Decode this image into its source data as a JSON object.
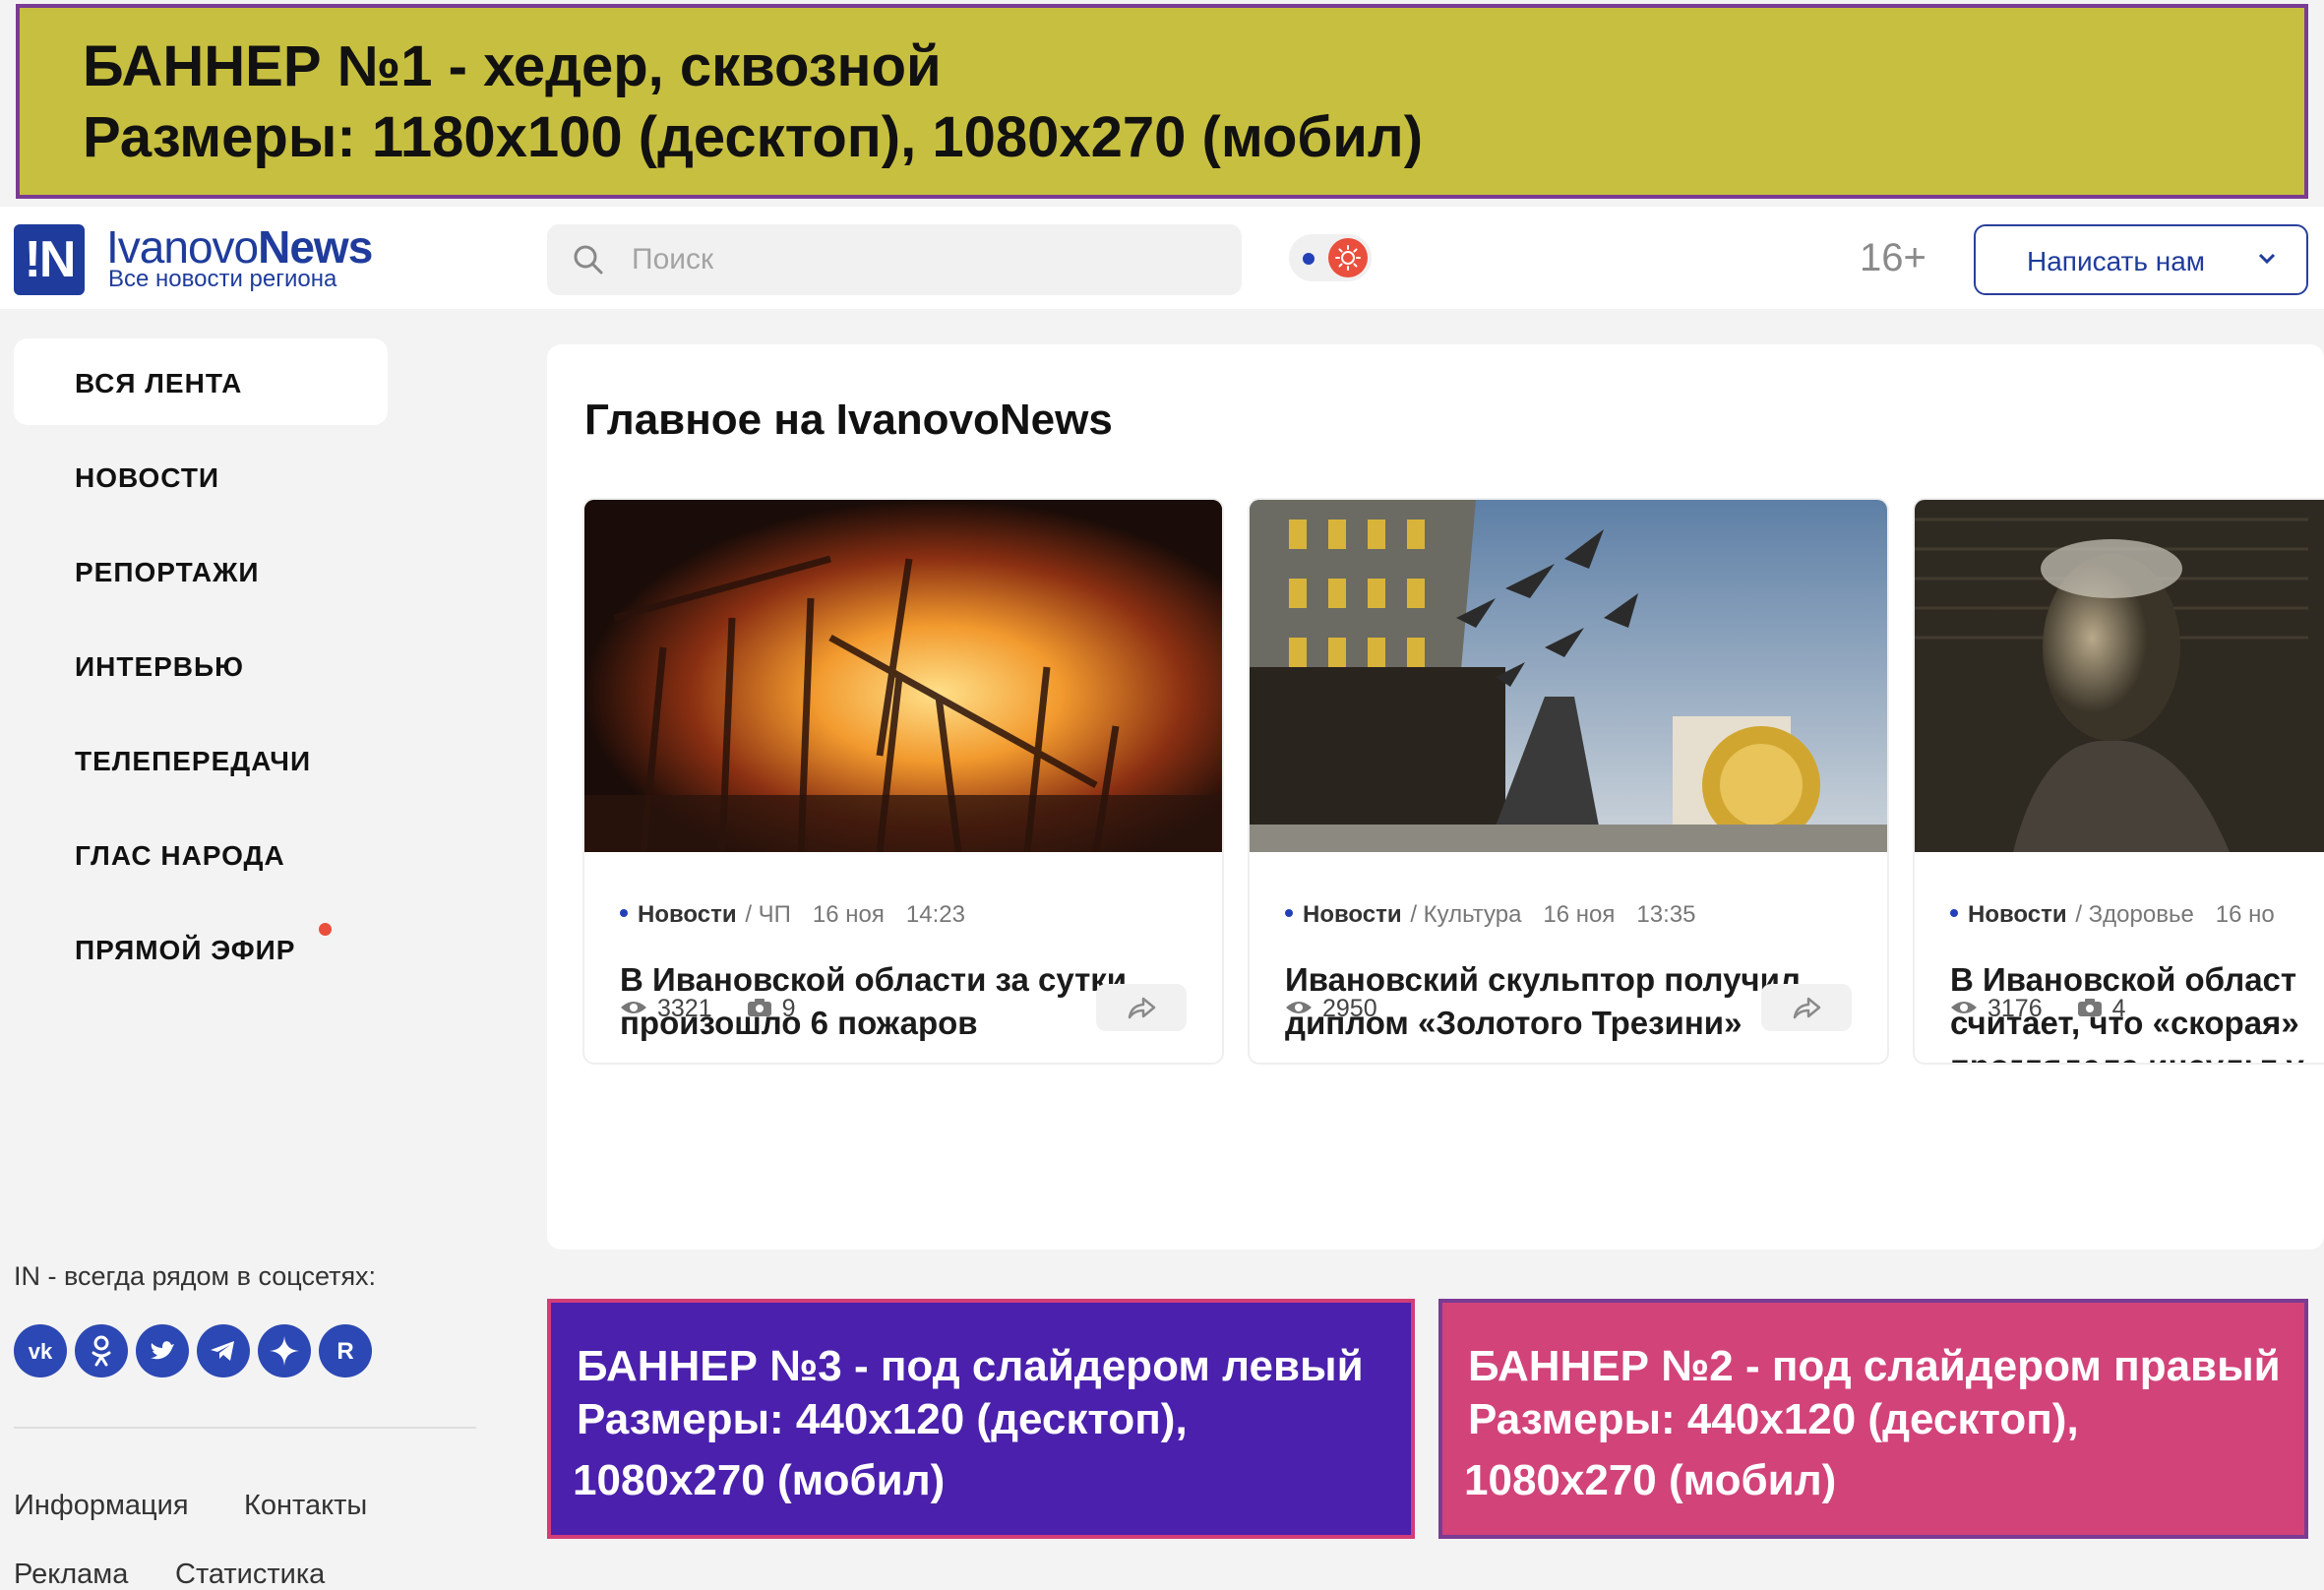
{
  "banners": {
    "top": {
      "line1": "БАННЕР №1 - хедер, сквозной",
      "line2": "Размеры: 1180x100 (десктоп),  1080x270 (мобил)",
      "color": "#c7bf3f"
    },
    "left": {
      "line1": "БАННЕР №3 - под слайдером левый",
      "line2": "Размеры: 440x120 (десктоп),",
      "line3": "1080x270 (мобил)",
      "color": "#4a20ad"
    },
    "right": {
      "line1": "БАННЕР №2 - под слайдером правый",
      "line2": "Размеры: 440x120 (десктоп),",
      "line3": "1080x270 (мобил)",
      "color": "#d2437a"
    }
  },
  "header": {
    "logo_mark": "!N",
    "logo_name_light": "Ivanovo",
    "logo_name_bold": "News",
    "logo_tagline": "Все новости региона",
    "search_placeholder": "Поиск",
    "age_rating": "16+",
    "write_button": "Написать нам",
    "brand_color": "#1f3c9c"
  },
  "sidebar": {
    "items": [
      {
        "label": "ВСЯ ЛЕНТА"
      },
      {
        "label": "НОВОСТИ"
      },
      {
        "label": "РЕПОРТАЖИ"
      },
      {
        "label": "ИНТЕРВЬЮ"
      },
      {
        "label": "ТЕЛЕПЕРЕДАЧИ"
      },
      {
        "label": "ГЛАС НАРОДА"
      },
      {
        "label": "ПРЯМОЙ ЭФИР"
      }
    ],
    "social_title": "IN - всегда рядом в соцсетях:",
    "socials": [
      {
        "icon": "vk-icon",
        "glyph": "vk"
      },
      {
        "icon": "odnoklassniki-icon",
        "glyph": "ok"
      },
      {
        "icon": "twitter-icon",
        "glyph": "tw"
      },
      {
        "icon": "telegram-icon",
        "glyph": "tg"
      },
      {
        "icon": "zen-icon",
        "glyph": "✦"
      },
      {
        "icon": "rutube-icon",
        "glyph": "R"
      }
    ],
    "footer_links": [
      "Информация",
      "Контакты",
      "Реклама",
      "Статистика"
    ]
  },
  "main": {
    "title": "Главное на IvanovoNews",
    "news": [
      {
        "category": "Новости",
        "subcategory": "/ ЧП",
        "date": "16 ноя",
        "time": "14:23",
        "headline": "В Ивановской области за сутки произошло 6 пожаров",
        "views": "3321",
        "photos": "9"
      },
      {
        "category": "Новости",
        "subcategory": "/ Культура",
        "date": "16 ноя",
        "time": "13:35",
        "headline": "Ивановский скульптор получил диплом «Золотого Трезини»",
        "views": "2950",
        "photos": ""
      },
      {
        "category": "Новости",
        "subcategory": "/ Здоровье",
        "date": "16 но",
        "time": "",
        "headline": "В Ивановской област считает, что «скорая» проглядела инсульт у",
        "views": "3176",
        "photos": "4"
      }
    ]
  }
}
